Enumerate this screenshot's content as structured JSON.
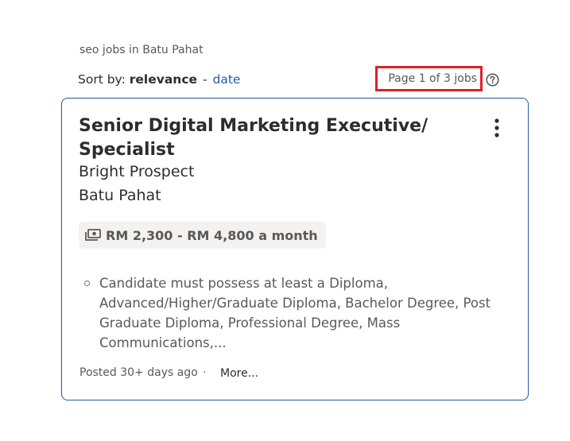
{
  "search": {
    "context": "seo jobs in Batu Pahat"
  },
  "sort": {
    "label": "Sort by:",
    "current": "relevance",
    "separator": "-",
    "alternate": "date"
  },
  "pagination": {
    "text": "Page 1 of 3 jobs"
  },
  "job": {
    "title": "Senior Digital Marketing Executive/ Specialist",
    "company": "Bright Prospect",
    "location": "Batu Pahat",
    "salary": "RM 2,300 - RM 4,800 a month",
    "snippet": "Candidate must possess at least a Diploma, Advanced/Higher/Graduate Diploma, Bachelor Degree, Post Graduate Diploma, Professional Degree, Mass Communications,...",
    "posted": "Posted 30+ days ago",
    "separator": "·",
    "more": "More..."
  },
  "colors": {
    "link": "#2557a7",
    "highlight": "#e0202a",
    "text": "#2d2d2d",
    "muted": "#595959"
  },
  "icons": {
    "help": "question-circle-icon",
    "menu": "vertical-ellipsis-icon",
    "salary": "money-icon",
    "bullet": "circle-bullet-icon"
  }
}
